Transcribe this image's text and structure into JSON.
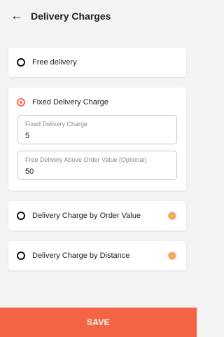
{
  "header": {
    "title": "Delivery Charges",
    "back_icon": "arrow-left-icon"
  },
  "options": {
    "free": {
      "label": "Free delivery",
      "selected": false
    },
    "fixed": {
      "label": "Fixed Delivery Charge",
      "selected": true,
      "fields": [
        {
          "label": "Fixed Delivery Charge",
          "value": "5"
        },
        {
          "label": "Free Delivery Above Order Value (Optional)",
          "value": "50"
        }
      ]
    },
    "by_order_value": {
      "label": "Delivery Charge by Order Value",
      "selected": false,
      "badge_icon": "premium-badge-icon"
    },
    "by_distance": {
      "label": "Delivery Charge by Distance",
      "selected": false,
      "badge_icon": "premium-badge-icon"
    }
  },
  "footer": {
    "save_label": "SAVE"
  },
  "colors": {
    "accent": "#f46444",
    "background": "#f3f3f3"
  }
}
